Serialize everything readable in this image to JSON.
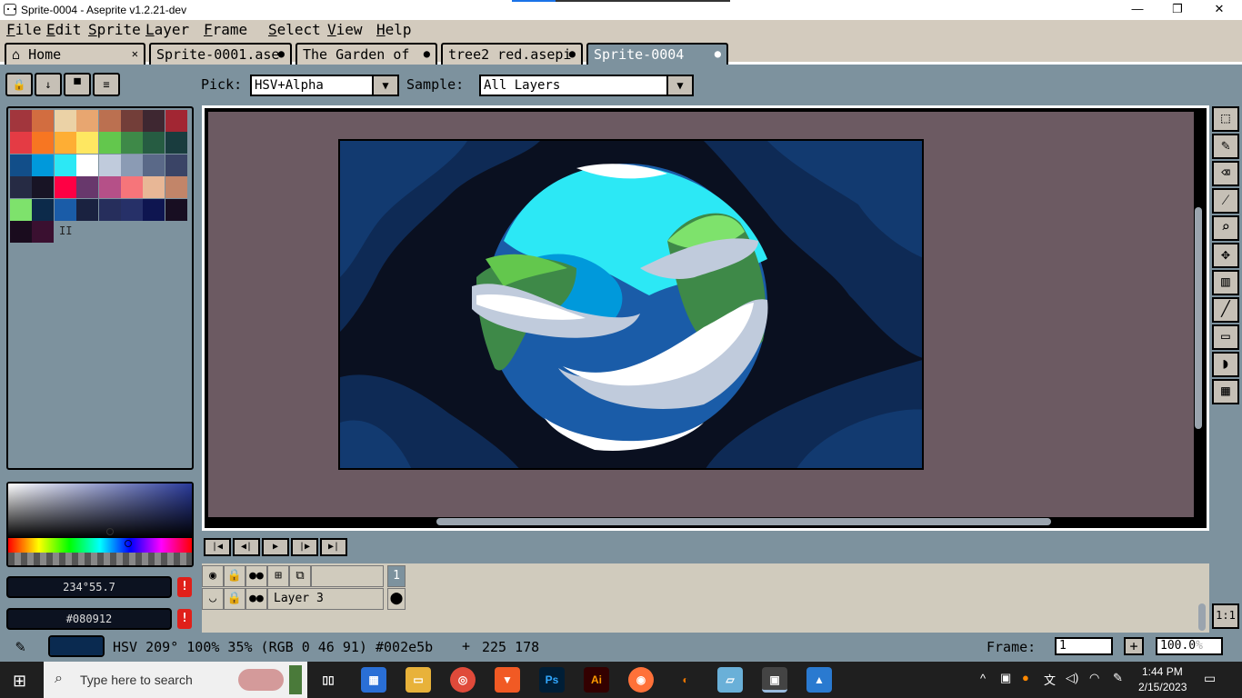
{
  "window": {
    "title": "Sprite-0004 - Aseprite v1.2.21-dev"
  },
  "menu": [
    "File",
    "Edit",
    "Sprite",
    "Layer",
    "Frame",
    "Select",
    "View",
    "Help"
  ],
  "tabs": [
    {
      "label": "Home",
      "icon": "home-icon"
    },
    {
      "label": "Sprite-0001.ase"
    },
    {
      "label": "The Garden of"
    },
    {
      "label": "tree2 red.asepi"
    },
    {
      "label": "Sprite-0004"
    }
  ],
  "eyedropper": {
    "pick_label": "Pick:",
    "pick_value": "HSV+Alpha",
    "sample_label": "Sample:",
    "sample_value": "All Layers"
  },
  "palette": {
    "colors": [
      "#a2363d",
      "#d26d40",
      "#ebd2a6",
      "#e8a670",
      "#bb7050",
      "#733e39",
      "#3e2731",
      "#a22633",
      "#e43b44",
      "#f77622",
      "#feae34",
      "#fee761",
      "#63c74d",
      "#3e8948",
      "#265c42",
      "#193c3e",
      "#124e89",
      "#0099db",
      "#2ce8f5",
      "#ffffff",
      "#c0cbdc",
      "#8b9bb4",
      "#5a6988",
      "#3a4466",
      "#262b44",
      "#181425",
      "#ff0044",
      "#68386c",
      "#b55088",
      "#f6757a",
      "#e8b796",
      "#c28569",
      "#7ee26c",
      "#0c2a4a",
      "#1a5ca8",
      "#1a2240",
      "#262e5c",
      "#263068",
      "#0e1550",
      "#180e22",
      "#1a0c1e",
      "#3a1030"
    ],
    "extra": "II"
  },
  "color_fields": {
    "hsv": "234°55.7",
    "hex": "#080912"
  },
  "layers": {
    "frame_header": "1",
    "layer_name": "Layer 3"
  },
  "status": {
    "text": "HSV 209° 100% 35% (RGB 0 46 91) #002e5b",
    "coords": "225 178",
    "fg_color": "#0a2a50",
    "frame_label": "Frame:",
    "frame_value": "1",
    "zoom": "100.0",
    "zoom_suffix": "%"
  },
  "taskbar": {
    "search_placeholder": "Type here to search",
    "time": "1:44 PM",
    "date": "2/15/2023",
    "apps": [
      "task-view",
      "store",
      "file-explorer",
      "chrome",
      "brave",
      "photoshop",
      "illustrator",
      "firefox",
      "blender",
      "notepad",
      "aseprite",
      "photos"
    ],
    "ps_label": "Ps",
    "ai_label": "Ai"
  }
}
